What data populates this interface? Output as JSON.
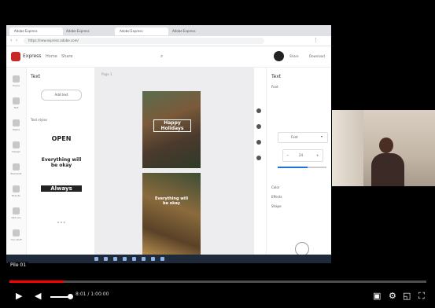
{
  "browser": {
    "tabs": [
      "Adobe Express",
      "Adobe Express",
      "Adobe Express",
      "Adobe Express"
    ],
    "url": "https://new.express.adobe.com/"
  },
  "app": {
    "name": "Express",
    "menus": [
      "Home",
      "Share"
    ],
    "top_buttons": [
      "Share",
      "Download"
    ]
  },
  "left_rail": {
    "items": [
      "Home",
      "Text",
      "Media",
      "Design",
      "Elements",
      "Brands",
      "Add-ons",
      "Your stuff"
    ]
  },
  "panel": {
    "title": "Text",
    "add_button": "Add text",
    "section_label": "Text styles",
    "samples": [
      "OPEN",
      "Everything will be okay",
      "Always",
      "..."
    ]
  },
  "canvas": {
    "page_label": "Page 1",
    "art1_text": "Happy Holidays",
    "art2_text": "Everything will be okay"
  },
  "right_panel": {
    "title": "Text",
    "subtitle": "Font",
    "font_name": "Font",
    "size_value": "24",
    "rows": [
      "Color",
      "Effects",
      "Shape"
    ],
    "opacity_fraction": 0.62
  },
  "player": {
    "subtitle_text": "Pile 01",
    "timecode": "8:01 / 1:00:00",
    "progress_fraction": 0.13,
    "volume_fraction": 0.9
  }
}
